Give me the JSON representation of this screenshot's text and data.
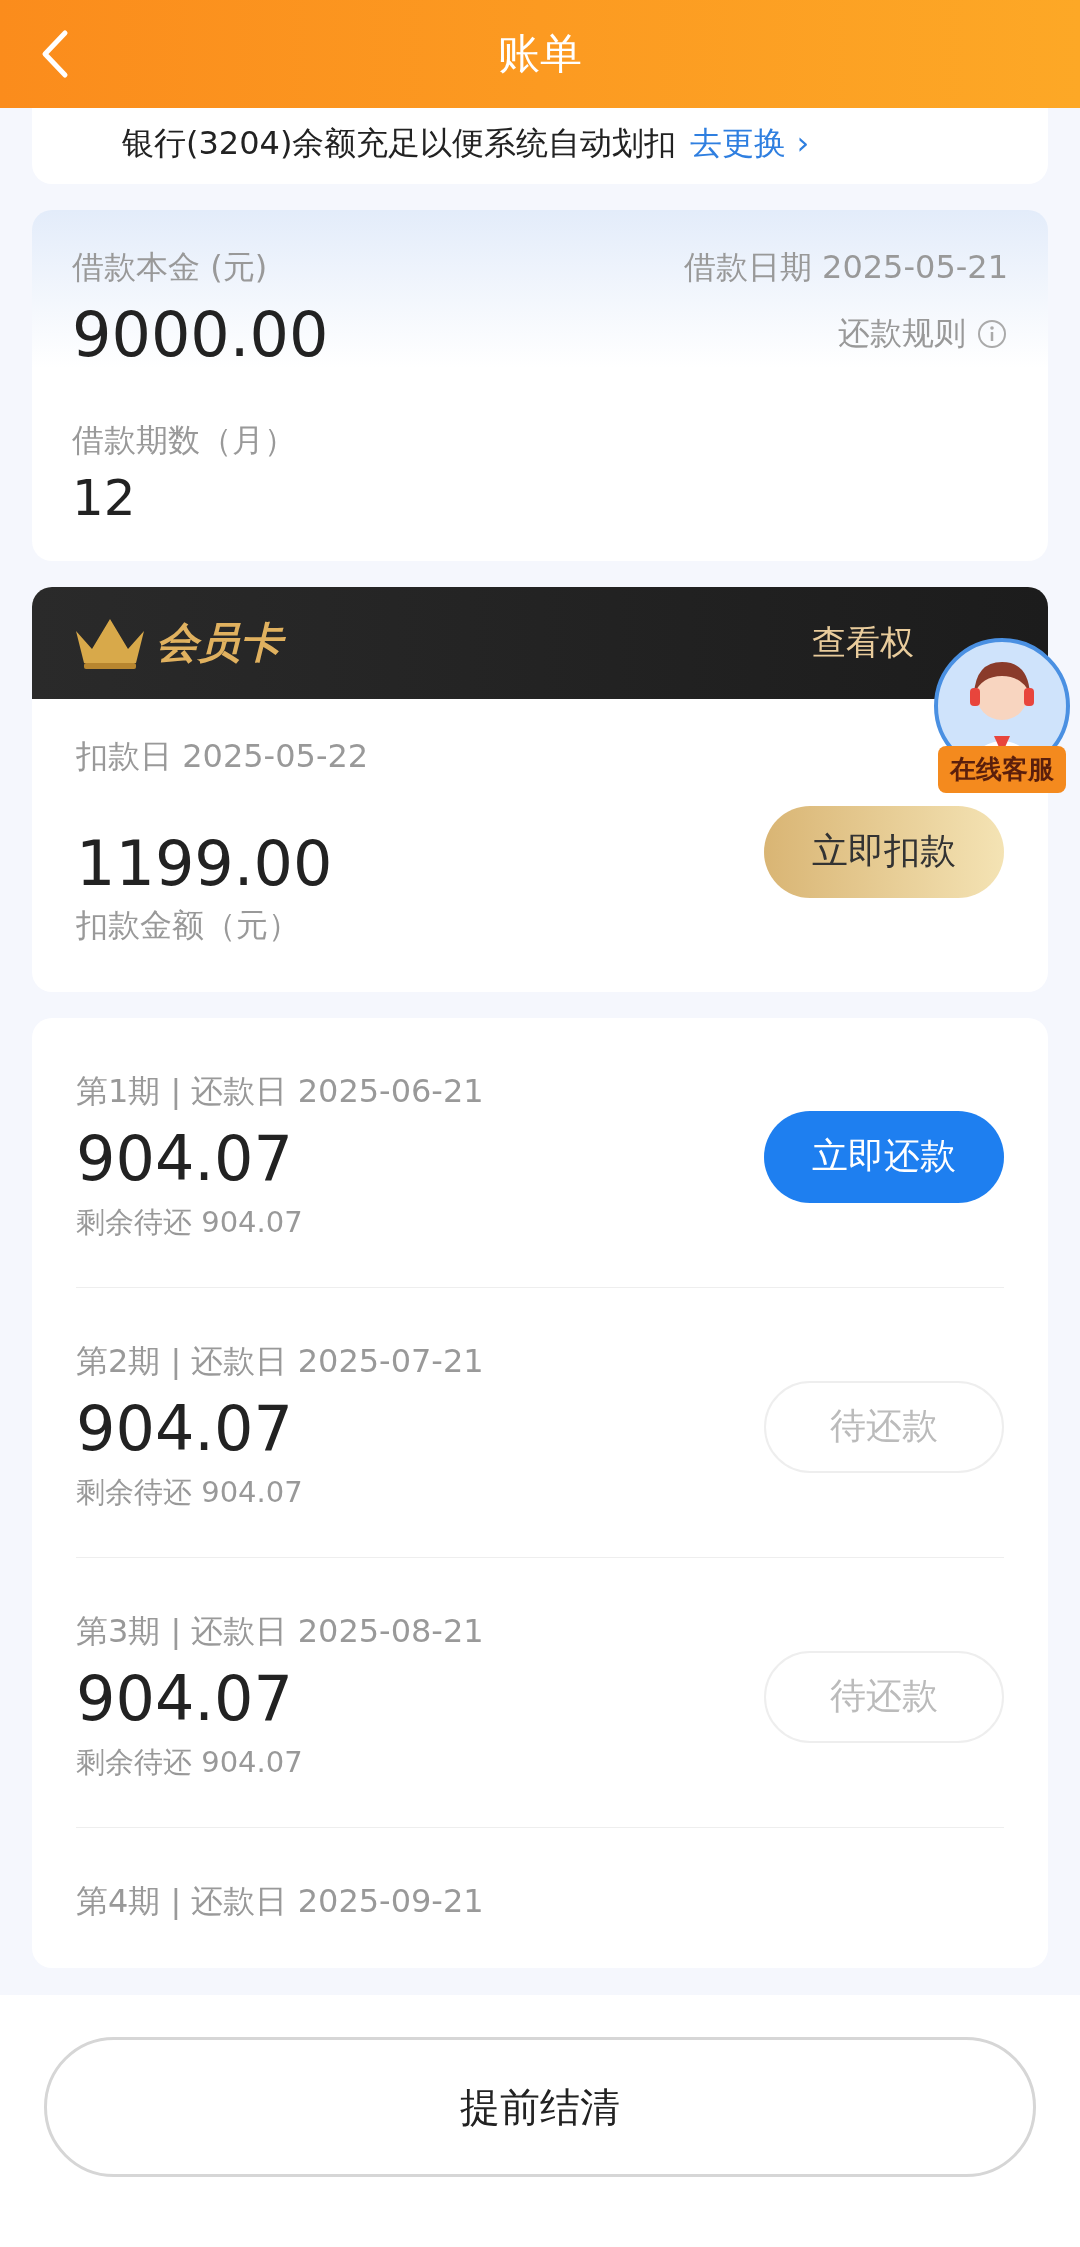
{
  "header": {
    "title": "账单"
  },
  "notice": {
    "text": "银行(3204)余额充足以便系统自动划扣",
    "link": "去更换 ›"
  },
  "loan": {
    "principal_label": "借款本金 (元)",
    "principal": "9000.00",
    "date": "借款日期 2025-05-21",
    "rules": "还款规则",
    "term_label": "借款期数（月）",
    "term": "12"
  },
  "member": {
    "title": "会员卡",
    "benefits": "查看权",
    "deduct_date": "扣款日 2025-05-22",
    "amount": "1199.00",
    "amount_label": "扣款金额（元）",
    "button": "立即扣款"
  },
  "service": {
    "label": "在线客服"
  },
  "installments": [
    {
      "title": "第1期 | 还款日 2025-06-21",
      "amount": "904.07",
      "remaining": "剩余待还 904.07",
      "kind": "pay",
      "button": "立即还款"
    },
    {
      "title": "第2期 | 还款日 2025-07-21",
      "amount": "904.07",
      "remaining": "剩余待还 904.07",
      "kind": "pending",
      "button": "待还款"
    },
    {
      "title": "第3期 | 还款日 2025-08-21",
      "amount": "904.07",
      "remaining": "剩余待还 904.07",
      "kind": "pending",
      "button": "待还款"
    },
    {
      "title": "第4期 | 还款日 2025-09-21"
    }
  ],
  "footer": {
    "button": "提前结清"
  }
}
